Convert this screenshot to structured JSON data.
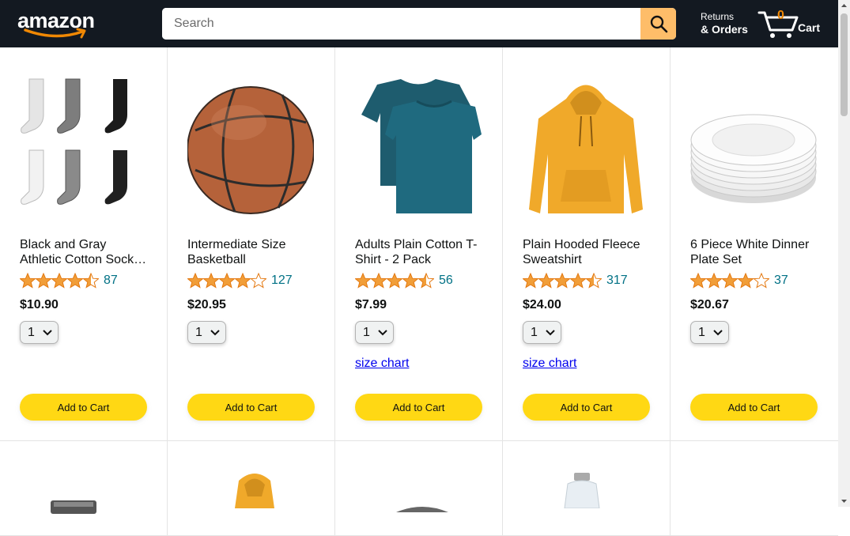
{
  "header": {
    "logo_text": "amazon",
    "search_placeholder": "Search",
    "search_value": "",
    "returns_line1": "Returns",
    "returns_line2": "& Orders",
    "cart_count": "0",
    "cart_label": "Cart"
  },
  "colors": {
    "header_bg": "#131921",
    "search_button": "#febd69",
    "add_to_cart": "#ffd814",
    "star": "#f19e39",
    "link": "#007185"
  },
  "products": [
    {
      "title": "Black and Gray Athletic Cotton Sock…",
      "rating": 4.5,
      "review_count": "87",
      "price": "$10.90",
      "qty": "1",
      "size_chart": "",
      "button": "Add to Cart",
      "image": "socks-image"
    },
    {
      "title": "Intermediate Size Basketball",
      "rating": 4.0,
      "review_count": "127",
      "price": "$20.95",
      "qty": "1",
      "size_chart": "",
      "button": "Add to Cart",
      "image": "basketball-image"
    },
    {
      "title": "Adults Plain Cotton T-Shirt - 2 Pack",
      "rating": 4.5,
      "review_count": "56",
      "price": "$7.99",
      "qty": "1",
      "size_chart": "size chart",
      "button": "Add to Cart",
      "image": "tshirt-image"
    },
    {
      "title": "Plain Hooded Fleece Sweatshirt",
      "rating": 4.5,
      "review_count": "317",
      "price": "$24.00",
      "qty": "1",
      "size_chart": "size chart",
      "button": "Add to Cart",
      "image": "hoodie-image"
    },
    {
      "title": "6 Piece White Dinner Plate Set",
      "rating": 4.0,
      "review_count": "37",
      "price": "$20.67",
      "qty": "1",
      "size_chart": "",
      "button": "Add to Cart",
      "image": "plates-image"
    }
  ],
  "next_row_images": [
    "toaster-image",
    "hoodie-image",
    "gray-item-image",
    "detergent-image",
    ""
  ]
}
